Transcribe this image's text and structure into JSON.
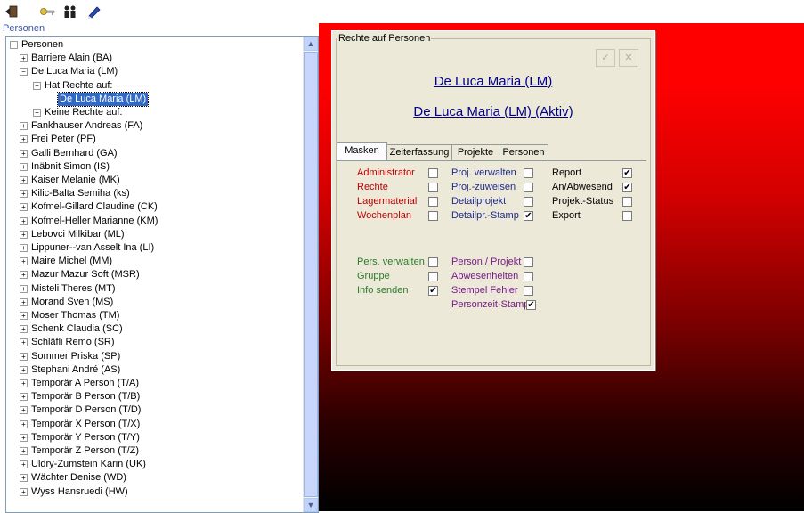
{
  "toolbar": {
    "icons": [
      "door-exit-icon",
      "key-icon",
      "users-icon",
      "pen-icon"
    ]
  },
  "left_panel": {
    "title": "Personen",
    "tree": [
      {
        "label": "Personen",
        "level": 0,
        "expander": "−"
      },
      {
        "label": "Barriere Alain (BA)",
        "level": 1,
        "expander": "+"
      },
      {
        "label": "De Luca Maria (LM)",
        "level": 1,
        "expander": "−"
      },
      {
        "label": "Hat Rechte auf:",
        "level": 2,
        "expander": "−"
      },
      {
        "label": "De Luca Maria (LM)",
        "level": 3,
        "expander": "",
        "selected": true
      },
      {
        "label": "Keine Rechte auf:",
        "level": 2,
        "expander": "+"
      },
      {
        "label": "Fankhauser Andreas (FA)",
        "level": 1,
        "expander": "+"
      },
      {
        "label": "Frei Peter (PF)",
        "level": 1,
        "expander": "+"
      },
      {
        "label": "Galli Bernhard (GA)",
        "level": 1,
        "expander": "+"
      },
      {
        "label": "Inäbnit Simon (IS)",
        "level": 1,
        "expander": "+"
      },
      {
        "label": "Kaiser Melanie (MK)",
        "level": 1,
        "expander": "+"
      },
      {
        "label": "Kilic-Balta Semiha (ks)",
        "level": 1,
        "expander": "+"
      },
      {
        "label": "Kofmel-Gillard Claudine (CK)",
        "level": 1,
        "expander": "+"
      },
      {
        "label": "Kofmel-Heller Marianne (KM)",
        "level": 1,
        "expander": "+"
      },
      {
        "label": "Lebovci Milkibar (ML)",
        "level": 1,
        "expander": "+"
      },
      {
        "label": "Lippuner--van Asselt Ina (LI)",
        "level": 1,
        "expander": "+"
      },
      {
        "label": "Maire Michel (MM)",
        "level": 1,
        "expander": "+"
      },
      {
        "label": "Mazur Mazur Soft (MSR)",
        "level": 1,
        "expander": "+"
      },
      {
        "label": "Misteli Theres (MT)",
        "level": 1,
        "expander": "+"
      },
      {
        "label": "Morand Sven (MS)",
        "level": 1,
        "expander": "+"
      },
      {
        "label": "Moser Thomas (TM)",
        "level": 1,
        "expander": "+"
      },
      {
        "label": "Schenk Claudia (SC)",
        "level": 1,
        "expander": "+"
      },
      {
        "label": "Schläfli Remo (SR)",
        "level": 1,
        "expander": "+"
      },
      {
        "label": "Sommer Priska (SP)",
        "level": 1,
        "expander": "+"
      },
      {
        "label": "Stephani André (AS)",
        "level": 1,
        "expander": "+"
      },
      {
        "label": "Temporär A Person (T/A)",
        "level": 1,
        "expander": "+"
      },
      {
        "label": "Temporär B Person (T/B)",
        "level": 1,
        "expander": "+"
      },
      {
        "label": "Temporär D Person (T/D)",
        "level": 1,
        "expander": "+"
      },
      {
        "label": "Temporär X  Person (T/X)",
        "level": 1,
        "expander": "+"
      },
      {
        "label": "Temporär Y Person (T/Y)",
        "level": 1,
        "expander": "+"
      },
      {
        "label": "Temporär Z Person (T/Z)",
        "level": 1,
        "expander": "+"
      },
      {
        "label": "Uldry-Zumstein Karin (UK)",
        "level": 1,
        "expander": "+"
      },
      {
        "label": "Wächter Denise (WD)",
        "level": 1,
        "expander": "+"
      },
      {
        "label": "Wyss Hansruedi (HW)",
        "level": 1,
        "expander": "+"
      }
    ],
    "scroll_up": "▲",
    "scroll_down": "▼"
  },
  "dialog": {
    "title": "Rechte auf Personen",
    "ok_button": "✓",
    "cancel_button": "✕",
    "person_name": "De Luca Maria (LM)",
    "person_active": "De Luca Maria (LM)  (Aktiv)",
    "tabs": [
      "Masken",
      "Zeiterfassung",
      "Projekte",
      "Personen"
    ],
    "active_tab": 0,
    "permissions": [
      {
        "label": "Administrator",
        "checked": false,
        "color": "red"
      },
      {
        "label": "Rechte",
        "checked": false,
        "color": "red"
      },
      {
        "label": "Lagermaterial",
        "checked": false,
        "color": "red"
      },
      {
        "label": "Wochenplan",
        "checked": false,
        "color": "red"
      },
      {
        "label": "Proj. verwalten",
        "checked": false,
        "color": "blue"
      },
      {
        "label": "Proj.-zuweisen",
        "checked": false,
        "color": "blue"
      },
      {
        "label": "Detailprojekt",
        "checked": false,
        "color": "blue"
      },
      {
        "label": "Detailpr.-Stamp",
        "checked": true,
        "color": "blue"
      },
      {
        "label": "Report",
        "checked": true,
        "color": "black"
      },
      {
        "label": "An/Abwesend",
        "checked": true,
        "color": "black"
      },
      {
        "label": "Projekt-Status",
        "checked": false,
        "color": "black"
      },
      {
        "label": "Export",
        "checked": false,
        "color": "black"
      },
      {
        "label": "Pers. verwalten",
        "checked": false,
        "color": "green"
      },
      {
        "label": "Gruppe",
        "checked": false,
        "color": "green"
      },
      {
        "label": "Info senden",
        "checked": true,
        "color": "green"
      },
      {
        "label": "Person / Projekt",
        "checked": false,
        "color": "purple"
      },
      {
        "label": "Abwesenheiten",
        "checked": false,
        "color": "purple"
      },
      {
        "label": "Stempel Fehler",
        "checked": false,
        "color": "purple"
      },
      {
        "label": "Personzeit-Stamp",
        "checked": true,
        "color": "purple"
      }
    ]
  },
  "colors": {
    "background_top": "#ff0000",
    "background_bottom": "#000000",
    "selection": "#316ac5",
    "dialog_bg": "#ece9d8"
  }
}
